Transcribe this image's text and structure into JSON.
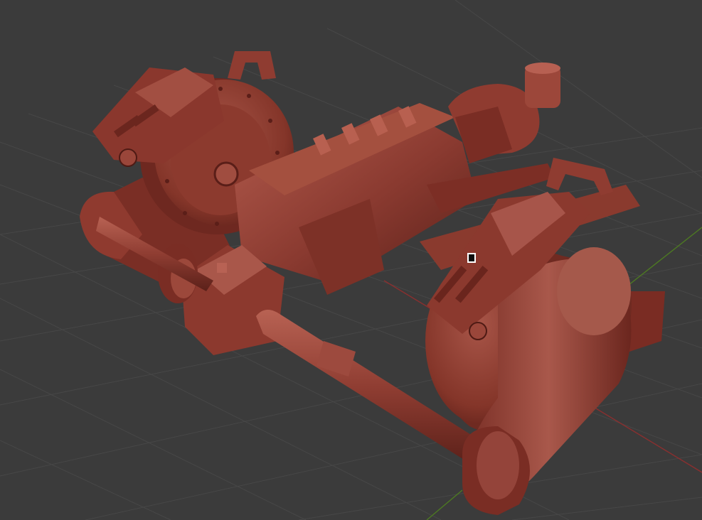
{
  "viewport": {
    "background": "#3b3b3b",
    "grid_color": "#4a4a4a",
    "x_axis_color": "#a33a3a",
    "y_axis_color": "#5a8a2a"
  },
  "model": {
    "description_icon": "engine-model-icon",
    "base_color": "#8a3a30",
    "highlight_color": "#b25a4c",
    "shadow_color": "#4a1a14"
  },
  "cursor": {
    "icon": "selection-cursor-icon"
  }
}
